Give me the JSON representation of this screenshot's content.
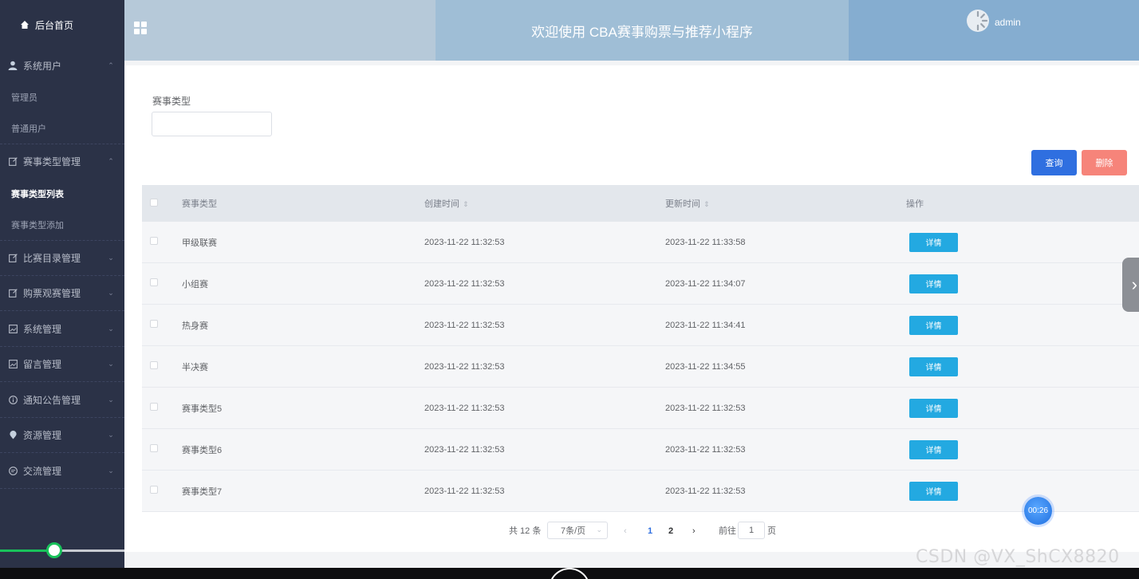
{
  "sidebar": {
    "home": "后台首页",
    "groups": [
      {
        "label": "系统用户",
        "items": [
          "管理员",
          "普通用户"
        ]
      },
      {
        "label": "赛事类型管理",
        "items": [
          "赛事类型列表",
          "赛事类型添加"
        ]
      },
      {
        "label": "比赛目录管理"
      },
      {
        "label": "购票观赛管理"
      },
      {
        "label": "系统管理"
      },
      {
        "label": "留言管理"
      },
      {
        "label": "通知公告管理"
      },
      {
        "label": "资源管理"
      },
      {
        "label": "交流管理"
      }
    ]
  },
  "header": {
    "title": "欢迎使用 CBA赛事购票与推荐小程序",
    "user": "admin"
  },
  "filter": {
    "label": "赛事类型",
    "value": ""
  },
  "buttons": {
    "query": "查询",
    "delete": "删除"
  },
  "table": {
    "columns": [
      "赛事类型",
      "创建时间",
      "更新时间",
      "操作"
    ],
    "rows": [
      {
        "type": "甲级联赛",
        "created": "2023-11-22 11:32:53",
        "updated": "2023-11-22 11:33:58",
        "action": "详情"
      },
      {
        "type": "小组赛",
        "created": "2023-11-22 11:32:53",
        "updated": "2023-11-22 11:34:07",
        "action": "详情"
      },
      {
        "type": "热身赛",
        "created": "2023-11-22 11:32:53",
        "updated": "2023-11-22 11:34:41",
        "action": "详情"
      },
      {
        "type": "半决赛",
        "created": "2023-11-22 11:32:53",
        "updated": "2023-11-22 11:34:55",
        "action": "详情"
      },
      {
        "type": "赛事类型5",
        "created": "2023-11-22 11:32:53",
        "updated": "2023-11-22 11:32:53",
        "action": "详情"
      },
      {
        "type": "赛事类型6",
        "created": "2023-11-22 11:32:53",
        "updated": "2023-11-22 11:32:53",
        "action": "详情"
      },
      {
        "type": "赛事类型7",
        "created": "2023-11-22 11:32:53",
        "updated": "2023-11-22 11:32:53",
        "action": "详情"
      }
    ]
  },
  "pagination": {
    "total": "共 12 条",
    "page_size": "7条/页",
    "pages": [
      "1",
      "2"
    ],
    "goto_label": "前往",
    "goto_value": "1",
    "goto_unit": "页"
  },
  "timer": "00:26",
  "watermark": "CSDN @VX_ShCX8820",
  "colors": {
    "sidebar_bg": "#2b3247",
    "primary": "#2f6fe0",
    "danger": "#f6847a",
    "detail": "#23a9e1",
    "progress": "#19c25b"
  }
}
